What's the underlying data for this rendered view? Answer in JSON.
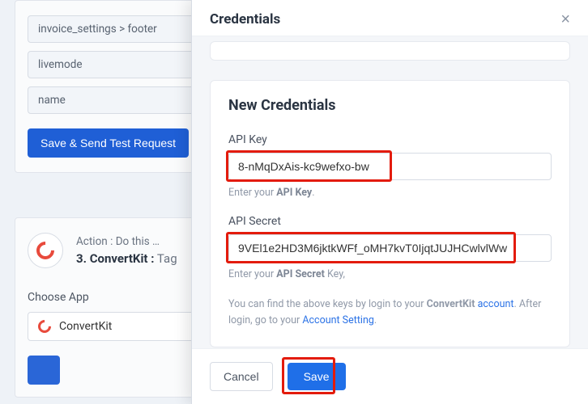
{
  "bg": {
    "fields": [
      "invoice_settings > footer",
      "livemode",
      "name"
    ],
    "save_send_label": "Save & Send Test Request",
    "action_prefix": "Action : Do this …",
    "action_num": "3.",
    "action_app": "ConvertKit :",
    "action_rest": "Tag",
    "choose_app_label": "Choose App",
    "choose_app_value": "ConvertKit"
  },
  "modal": {
    "title": "Credentials",
    "card_title": "New Credentials",
    "apikey": {
      "label": "API Key",
      "value": "8-nMqDxAis-kc9wefxo-bw",
      "hint_prefix": "Enter your ",
      "hint_bold": "API Key",
      "hint_suffix": "."
    },
    "apisecret": {
      "label": "API Secret",
      "value": "9VEl1e2HD3M6jktkWFf_oMH7kvT0IjqtJUJHCwlvlWw",
      "hint_prefix": "Enter your ",
      "hint_bold": "API Secret",
      "hint_suffix": " Key,"
    },
    "info_part1": "You can find the above keys by login to your ",
    "info_brand": "ConvertKit",
    "info_account": "account",
    "info_part2": ". After login, go to your ",
    "info_link": "Account Setting",
    "info_part3": ".",
    "cancel": "Cancel",
    "save": "Save"
  }
}
